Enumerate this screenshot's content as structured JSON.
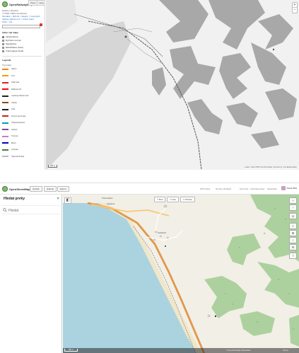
{
  "top": {
    "brand": "OpenRailwayMap",
    "tabs": [
      "Zoom",
      "Lang"
    ],
    "intro_lines": [
      "Nearby Lithuania",
      "© OSM, ORM contributors"
    ],
    "breadcrumb": "Slovakia > Rybník > Region > Copyright",
    "breadcrumb2": "railway-stations-ice > Trains rated",
    "breadcrumb3": "Orbit > Intl.",
    "style_section": "Vyber styl mapy",
    "styles": [
      {
        "label": "Infrastruktura",
        "selected": true
      },
      {
        "label": "Rychlost na trati",
        "selected": false
      },
      {
        "label": "Signalizace",
        "selected": false
      },
      {
        "label": "Elektrifikace (beta)",
        "selected": false
      },
      {
        "label": "Track gauge (beta)",
        "selected": false
      }
    ],
    "legend_section": "Legenda",
    "legend_subtitle": "Typ kolejí",
    "legend": [
      {
        "label": "Hlavní",
        "color": "#ff8100"
      },
      {
        "label": "Trať",
        "color": "#f39f00"
      },
      {
        "label": "Částí trati",
        "color": "#dd2222"
      },
      {
        "label": "Dálková trať",
        "color": "#ff0000"
      },
      {
        "label": "Vysokorychlostní trať",
        "color": "#222222"
      },
      {
        "label": "Vlečka",
        "color": "#87491d"
      },
      {
        "label": "Uzle",
        "color": "#1c1c1c"
      },
      {
        "label": "Provoz pod trolejí",
        "color": "#c62222"
      },
      {
        "label": "Veřejná doprava",
        "color": "#0099cc"
      },
      {
        "label": "Ostatní",
        "color": "#7a4b8e"
      },
      {
        "label": "Tramvaj",
        "color": "#d877b8"
      },
      {
        "label": "Metro",
        "color": "#0300c3"
      },
      {
        "label": "Lanovka",
        "color": "#4a7a3a"
      },
      {
        "label": "Úzkorozchodná",
        "color": "#bbbbbb"
      }
    ],
    "map_attrib": "Leaflet | Data ORM OpenStreetMap | Rendering: OpenRailwayMap",
    "map_scale": "200 m"
  },
  "bottom": {
    "brand": "OpenStreetMap",
    "edit_buttons": [
      "Upravit",
      "Historie",
      "Export"
    ],
    "nav_links": [
      "GPS stopy",
      "Deníky uživatelů",
      "Komunity",
      "Autorská práva",
      "Nápověda",
      "O projektu"
    ],
    "user": "David Wild",
    "sidebar_title": "Hledat prvky",
    "search_placeholder": "Hledat",
    "map_toolbar": [
      {
        "label": "Bod",
        "icon": "+"
      },
      {
        "label": "Linie",
        "icon": "/"
      },
      {
        "label": "Plocha",
        "icon": "▱"
      }
    ],
    "map_labels": [
      {
        "text": "Kagaana",
        "type": "town"
      },
      {
        "text": "Pokemkapie",
        "type": "place"
      },
      {
        "text": "Heltiabad",
        "type": "place"
      }
    ],
    "scale_label": "500 m",
    "attribution": "© OpenStreetMap přispěvatelé",
    "status": "Úpravy"
  }
}
